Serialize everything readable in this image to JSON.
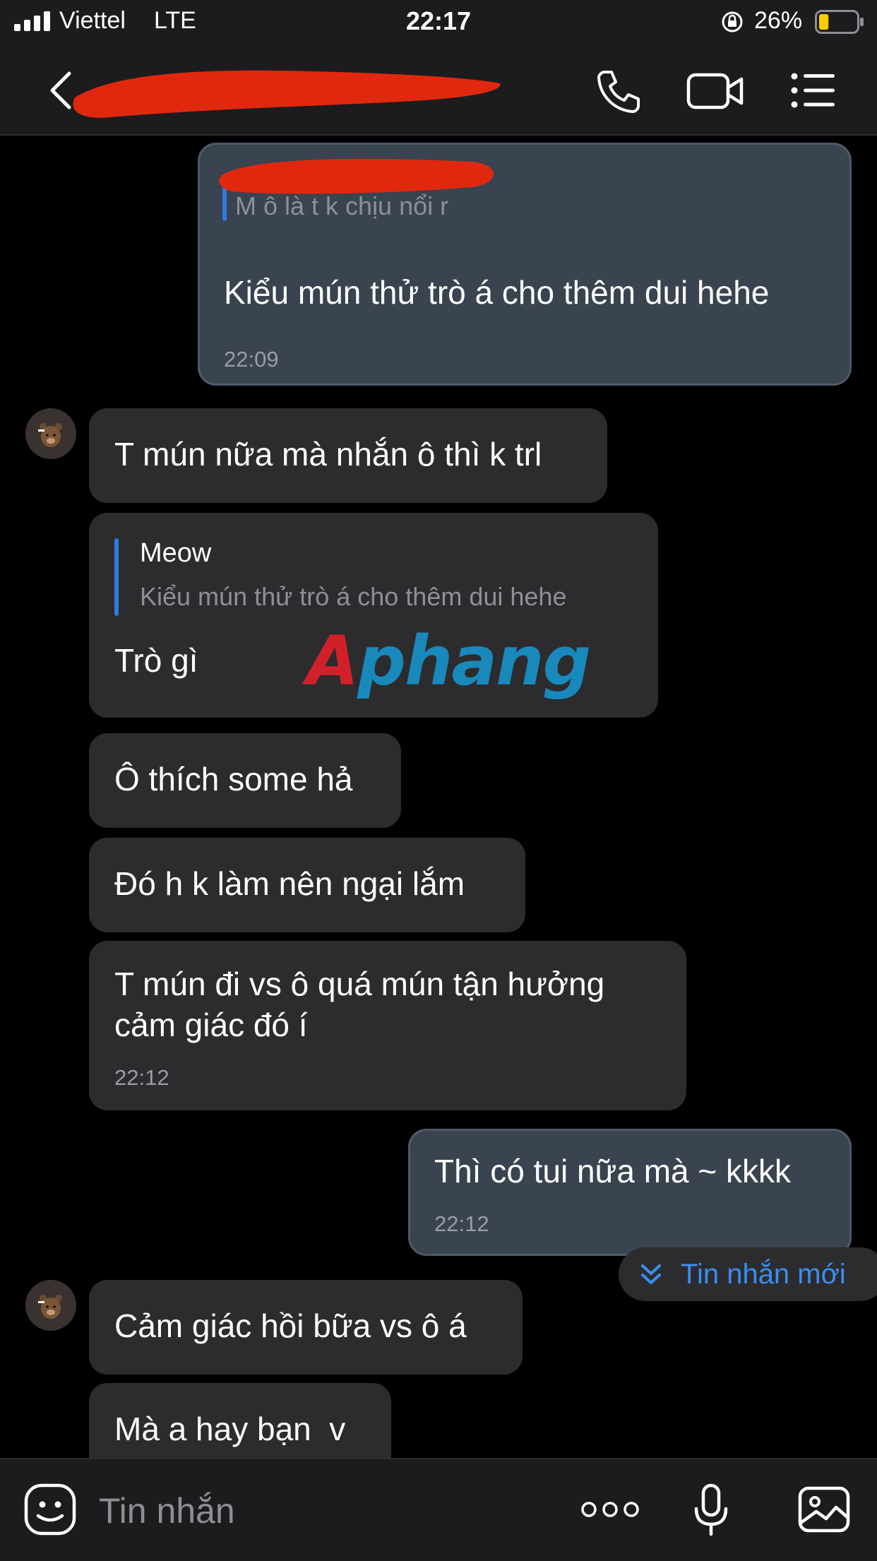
{
  "status_bar": {
    "carrier": "Viettel",
    "network": "LTE",
    "time": "22:17",
    "battery": "26%",
    "battery_level": 0.26
  },
  "header": {
    "contact_name": "",
    "icons": [
      "back-icon",
      "call-icon",
      "video-icon",
      "menu-icon"
    ]
  },
  "messages": [
    {
      "direction": "out",
      "quote_text": "M ô là t k chịu nổi r",
      "text": "Kiểu mún thử trò á cho thêm dui hehe",
      "time": "22:09"
    },
    {
      "direction": "in",
      "text": "T mún nữa mà nhắn ô thì k trl"
    },
    {
      "direction": "in",
      "quote_name": "Meow",
      "quote_text": "Kiểu mún thử trò á cho thêm dui hehe",
      "text": "Trò gì"
    },
    {
      "direction": "in",
      "text": "Ô thích some hả"
    },
    {
      "direction": "in",
      "text": "Đó h k làm nên ngại lắm"
    },
    {
      "direction": "in",
      "lines": [
        "T mún đi vs ô quá mún tận hưởng",
        "cảm giác đó í"
      ],
      "time": "22:12"
    },
    {
      "direction": "out",
      "text": "Thì có tui nữa mà ~ kkkk",
      "time": "22:12"
    },
    {
      "direction": "in",
      "text": "Cảm giác hồi bữa vs ô á"
    },
    {
      "direction": "in",
      "text": "Mà a hay bạn  v"
    }
  ],
  "watermark": {
    "first": "A",
    "rest": "phang"
  },
  "new_messages_button": "Tin nhắn mới",
  "input": {
    "placeholder": "Tin nhắn"
  },
  "colors": {
    "background": "#000000",
    "incoming_bubble": "#2c2c2e",
    "outgoing_bubble": "#3a4350",
    "accent": "#2b7de0",
    "redaction": "#e0280f"
  }
}
